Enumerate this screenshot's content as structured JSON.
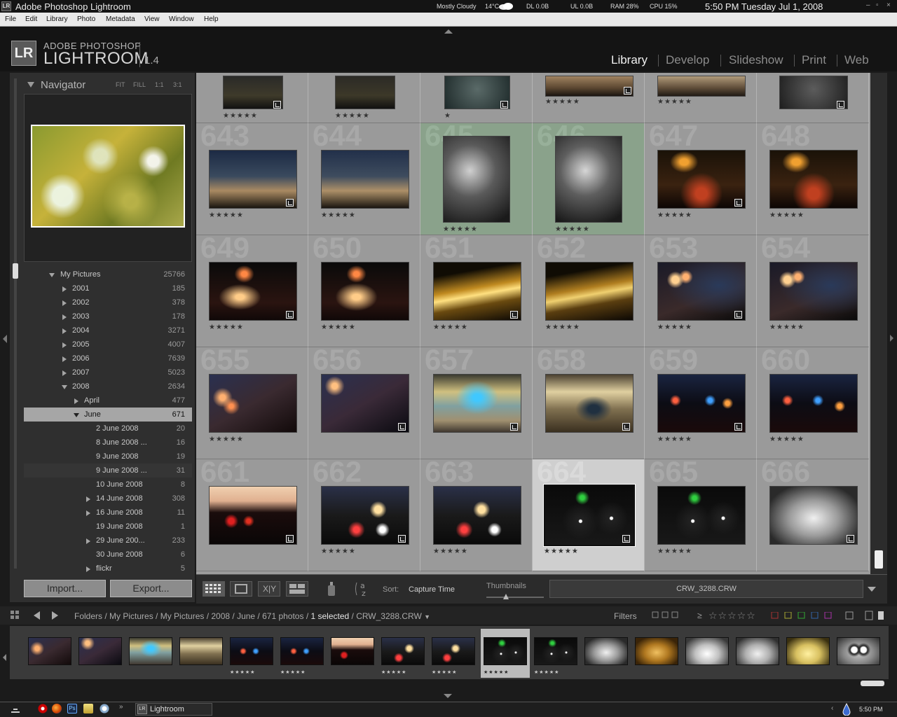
{
  "window": {
    "title": "Adobe Photoshop Lightroom",
    "weather": "Mostly Cloudy",
    "temp": "14°C",
    "dl": "DL 0.0B",
    "ul": "UL 0.0B",
    "ram": "RAM 28%",
    "cpu": "CPU 15%",
    "clock": "5:50 PM Tuesday Jul 1, 2008"
  },
  "menu": [
    "File",
    "Edit",
    "Library",
    "Photo",
    "Metadata",
    "View",
    "Window",
    "Help"
  ],
  "brand": {
    "badge": "LR",
    "line1": "ADOBE PHOTOSHOP",
    "line2": "LIGHTROOM",
    "version": "1.4"
  },
  "modules": [
    "Library",
    "Develop",
    "Slideshow",
    "Print",
    "Web"
  ],
  "navigator": {
    "title": "Navigator",
    "options": [
      "FIT",
      "FILL",
      "1:1",
      "3:1"
    ]
  },
  "folders": [
    {
      "label": "My Pictures",
      "count": "25766"
    },
    {
      "label": "2001",
      "count": "185"
    },
    {
      "label": "2002",
      "count": "378"
    },
    {
      "label": "2003",
      "count": "178"
    },
    {
      "label": "2004",
      "count": "3271"
    },
    {
      "label": "2005",
      "count": "4007"
    },
    {
      "label": "2006",
      "count": "7639"
    },
    {
      "label": "2007",
      "count": "5023"
    },
    {
      "label": "2008",
      "count": "2634"
    },
    {
      "label": "April",
      "count": "477"
    },
    {
      "label": "June",
      "count": "671"
    },
    {
      "label": "2 June 2008",
      "count": "20"
    },
    {
      "label": "8 June 2008 ...",
      "count": "16"
    },
    {
      "label": "9 June 2008",
      "count": "19"
    },
    {
      "label": "9 June 2008 ...",
      "count": "31"
    },
    {
      "label": "10 June 2008",
      "count": "8"
    },
    {
      "label": "14 June 2008",
      "count": "308"
    },
    {
      "label": "16 June 2008",
      "count": "11"
    },
    {
      "label": "19 June 2008",
      "count": "1"
    },
    {
      "label": "29 June 200...",
      "count": "233"
    },
    {
      "label": "30 June 2008",
      "count": "6"
    },
    {
      "label": "flickr",
      "count": "5"
    }
  ],
  "buttons": {
    "import": "Import...",
    "export": "Export..."
  },
  "grid": {
    "rows": [
      [
        "643",
        "644",
        "645",
        "646",
        "647",
        "648"
      ],
      [
        "649",
        "650",
        "651",
        "652",
        "653",
        "654"
      ],
      [
        "655",
        "656",
        "657",
        "658",
        "659",
        "660"
      ],
      [
        "661",
        "662",
        "663",
        "664",
        "665",
        "666"
      ]
    ],
    "stars": "★★★★★",
    "single_star": "★"
  },
  "toolbar": {
    "sort_label": "Sort:",
    "sort_value": "Capture Time",
    "thumbs_label": "Thumbnails",
    "filename": "CRW_3288.CRW",
    "xy": "X|Y"
  },
  "filmstrip_bar": {
    "path_plain": "Folders / My Pictures / My Pictures / 2008 / June / 671 photos / ",
    "path_selected": "1 selected",
    "path_file": " / CRW_3288.CRW",
    "filters_label": "Filters",
    "rating_op": "≥",
    "filter_stars": "☆☆☆☆☆"
  },
  "filmstrip": {
    "stars": "★★★★★"
  },
  "taskbar": {
    "app": "Lightroom",
    "app_badge": "LR",
    "time": "5:50 PM"
  }
}
